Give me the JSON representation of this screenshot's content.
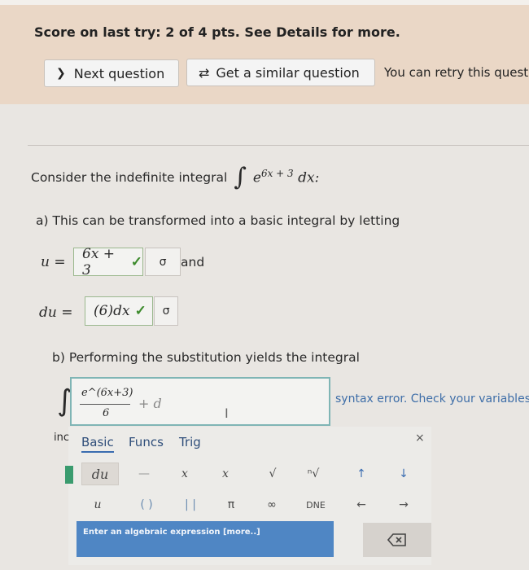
{
  "banner": {
    "score_text": "Score on last try: 2 of 4 pts. See Details for more.",
    "next_button": "Next question",
    "similar_button": "Get a similar question",
    "retry_text": "You can retry this question"
  },
  "question": {
    "prompt": "Consider the indefinite integral",
    "integral_base": "e",
    "integral_exponent": "6x + 3",
    "integral_differential": "dx:"
  },
  "part_a": {
    "instruction": "a) This can be transformed into a basic integral by letting",
    "u_label": "u =",
    "u_value": "6x + 3",
    "and_text": "and",
    "du_label": "du =",
    "du_value": "(6)dx"
  },
  "part_b": {
    "instruction": "b) Performing the substitution yields the integral",
    "frac_numerator": "e^(6x+3)",
    "frac_denominator": "6",
    "plus_c": "+ d",
    "cursor": "I",
    "syntax_error": "syntax error. Check your variables"
  },
  "palette": {
    "inc_label": "inc",
    "tabs": [
      "Basic",
      "Funcs",
      "Trig"
    ],
    "close": "×",
    "keys_row1": [
      "du",
      "—",
      "x",
      "x",
      "√",
      "ⁿ√",
      "↑",
      "↓"
    ],
    "keys_row2": [
      "u",
      "( )",
      "| |",
      "π",
      "∞",
      "DNE",
      "←",
      "→"
    ],
    "hint": "Enter an algebraic expression [more..]"
  },
  "colors": {
    "banner": "#ead7c6",
    "check": "#3d8b2d",
    "accent_blue": "#4f86c4",
    "error_text": "#3e6ea8"
  }
}
